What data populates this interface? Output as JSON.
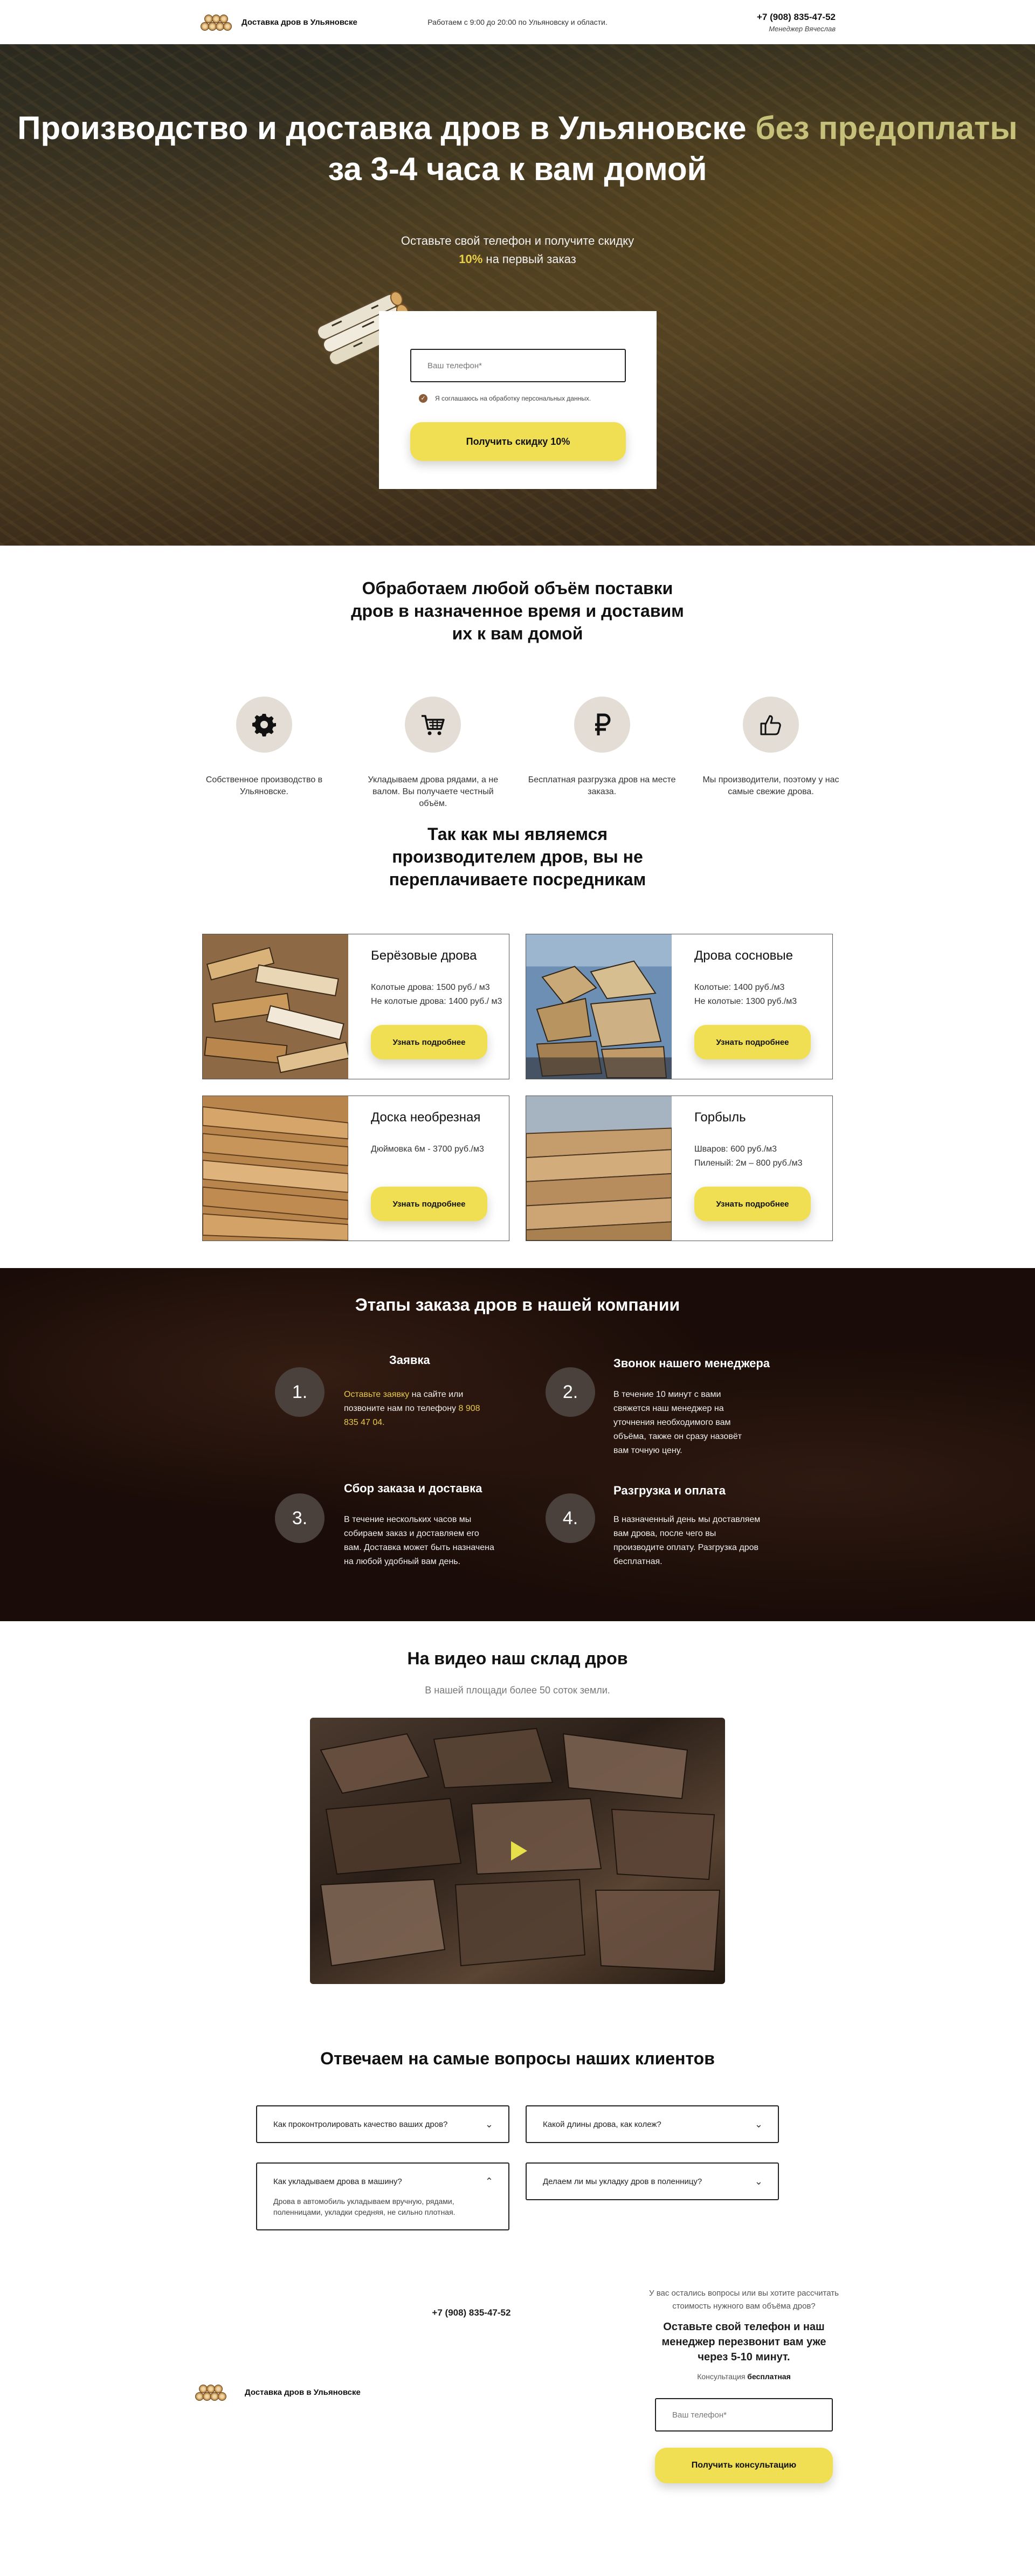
{
  "header": {
    "brand": "Доставка дров в Ульяновске",
    "hours": "Работаем с 9:00 до 20:00 по Ульяновску и области.",
    "phone": "+7 (908) 835-47-52",
    "manager": "Менеджер Вячеслав"
  },
  "hero": {
    "title_a": "Производство и доставка дров в Ульяновске ",
    "title_hl": "без предоплаты",
    "title_b": " за 3-4 часа к вам домой",
    "sub_a": "Оставьте свой телефон и получите скидку",
    "sub_pct": "10%",
    "sub_b": " на первый заказ",
    "phone_placeholder": "Ваш телефон*",
    "agree": "Я соглашаюсь на обработку персональных данных.",
    "button": "Получить скидку 10%"
  },
  "features": {
    "title": "Обработаем любой объём поставки дров в назначенное время и доставим их к вам домой",
    "items": [
      {
        "icon": "gear-icon",
        "text": "Собственное производство в Ульяновске."
      },
      {
        "icon": "cart-icon",
        "text": "Укладываем дрова рядами, а не валом. Вы получаете честный объём."
      },
      {
        "icon": "ruble-icon",
        "text": "Бесплатная разгрузка дров на месте заказа."
      },
      {
        "icon": "thumbs-up-icon",
        "text": "Мы производители, поэтому у нас самые свежие дрова."
      }
    ]
  },
  "products": {
    "title": "Так как мы являемся производителем дров, вы не переплачиваете посредникам",
    "button": "Узнать подробнее",
    "items": [
      {
        "name": "Берёзовые дрова",
        "price1": "Колотые дрова: 1500 руб./ м3",
        "price2": "Не колотые дрова: 1400 руб./ м3"
      },
      {
        "name": "Дрова сосновые",
        "price1": "Колотые: 1400 руб./м3",
        "price2": "Не колотые: 1300 руб./м3"
      },
      {
        "name": "Доска необрезная",
        "price1": "Дюймовка 6м - 3700 руб./м3",
        "price2": ""
      },
      {
        "name": "Горбыль",
        "price1": "Шваров: 600 руб./м3",
        "price2": "Пиленый: 2м – 800 руб./м3"
      }
    ]
  },
  "steps": {
    "title": "Этапы заказа дров в нашей компании",
    "items": [
      {
        "num": "1.",
        "head": "Заявка",
        "link": "Оставьте заявку",
        "body": " на сайте или позвоните нам по телефону ",
        "phone": "8 908 835 47 04."
      },
      {
        "num": "2.",
        "head": "Звонок нашего менеджера",
        "body": "В течение 10 минут с вами свяжется наш менеджер на уточнения необходимого вам объёма, также он сразу назовёт вам точную цену."
      },
      {
        "num": "3.",
        "head": "Сбор заказа и доставка",
        "body": "В течение нескольких часов мы собираем заказ и доставляем его вам. Доставка может быть назначена на любой удобный вам день."
      },
      {
        "num": "4.",
        "head": "Разгрузка и оплата",
        "body": "В назначенный день мы доставляем вам дрова, после чего вы производите оплату. Разгрузка дров бесплатная."
      }
    ]
  },
  "video": {
    "title": "На видео наш склад дров",
    "sub": "В нашей площади более 50 соток земли."
  },
  "faq": {
    "title": "Отвечаем на самые вопросы наших клиентов",
    "items": [
      {
        "q": "Как проконтролировать качество ваших дров?",
        "open": false
      },
      {
        "q": "Какой длины дрова, как колеж?",
        "open": false
      },
      {
        "q": "Как укладываем дрова в машину?",
        "open": true,
        "a": "Дрова в автомобиль укладываем вручную, рядами, поленницами, укладки средняя, не сильно плотная."
      },
      {
        "q": "Делаем ли мы укладку дров в поленницу?",
        "open": false
      }
    ]
  },
  "footer": {
    "brand": "Доставка дров в Ульяновске",
    "phone": "+7 (908) 835-47-52",
    "question": "У вас остались вопросы или вы хотите рассчитать стоимость нужного вам объёма дров?",
    "head": "Оставьте свой телефон и наш менеджер перезвонит вам уже через 5-10 минут.",
    "sub_a": "Консультация ",
    "sub_b": "бесплатная",
    "placeholder": "Ваш телефон*",
    "button": "Получить консультацию"
  },
  "colors": {
    "accent": "#f0df52",
    "highlight": "#c5c07a",
    "dark": "#1a0c08"
  }
}
